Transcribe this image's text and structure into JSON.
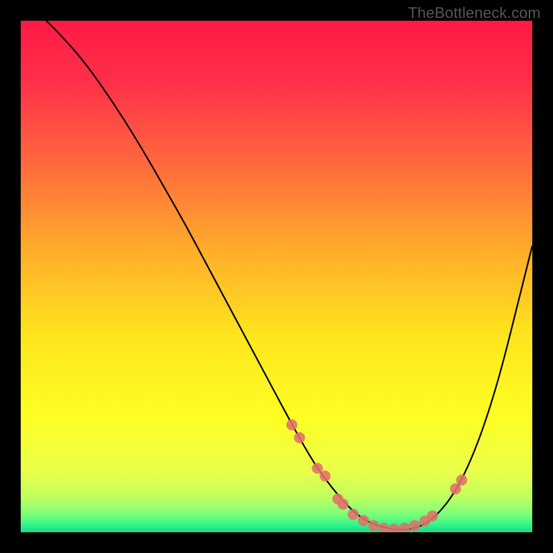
{
  "watermark": "TheBottleneck.com",
  "chart_data": {
    "type": "line",
    "title": "",
    "xlabel": "",
    "ylabel": "",
    "xlim": [
      0,
      100
    ],
    "ylim": [
      0,
      100
    ],
    "grid": false,
    "legend": false,
    "background_gradient": {
      "stops": [
        {
          "pos": 0.0,
          "color": "#ff1a44"
        },
        {
          "pos": 0.12,
          "color": "#ff3049"
        },
        {
          "pos": 0.28,
          "color": "#ff693e"
        },
        {
          "pos": 0.45,
          "color": "#ffad2a"
        },
        {
          "pos": 0.62,
          "color": "#ffe61e"
        },
        {
          "pos": 0.78,
          "color": "#fdff24"
        },
        {
          "pos": 0.88,
          "color": "#eaff4a"
        },
        {
          "pos": 0.93,
          "color": "#c2ff5e"
        },
        {
          "pos": 0.965,
          "color": "#7cff7a"
        },
        {
          "pos": 0.985,
          "color": "#34f58a"
        },
        {
          "pos": 1.0,
          "color": "#18d98a"
        }
      ]
    },
    "series": [
      {
        "name": "bottleneck-curve",
        "type": "line",
        "color": "#000000",
        "width": 2.2,
        "x": [
          5,
          8,
          12,
          16,
          20,
          24,
          28,
          32,
          36,
          40,
          44,
          48,
          52,
          55,
          58,
          61,
          64,
          67,
          70,
          73,
          76,
          79,
          82,
          85,
          88,
          91,
          94,
          97,
          100
        ],
        "y": [
          100,
          97,
          92.5,
          87,
          81,
          74.5,
          67.5,
          60.5,
          53,
          45.5,
          38,
          30.5,
          23,
          17.5,
          12.5,
          8.5,
          5,
          2.5,
          1.2,
          0.5,
          0.5,
          1.5,
          4,
          8,
          14,
          22,
          32,
          44,
          56
        ]
      },
      {
        "name": "highlight-points",
        "type": "scatter",
        "color": "#e2716a",
        "radius": 8,
        "x": [
          53,
          54.5,
          58,
          59.5,
          62,
          63,
          65,
          67,
          69,
          71,
          73,
          75,
          77,
          79,
          80.5,
          85,
          86.2
        ],
        "y": [
          21,
          18.5,
          12.5,
          11,
          6.5,
          5.5,
          3.5,
          2.3,
          1.3,
          0.8,
          0.6,
          0.8,
          1.3,
          2.2,
          3.2,
          8.5,
          10.2
        ]
      }
    ]
  }
}
